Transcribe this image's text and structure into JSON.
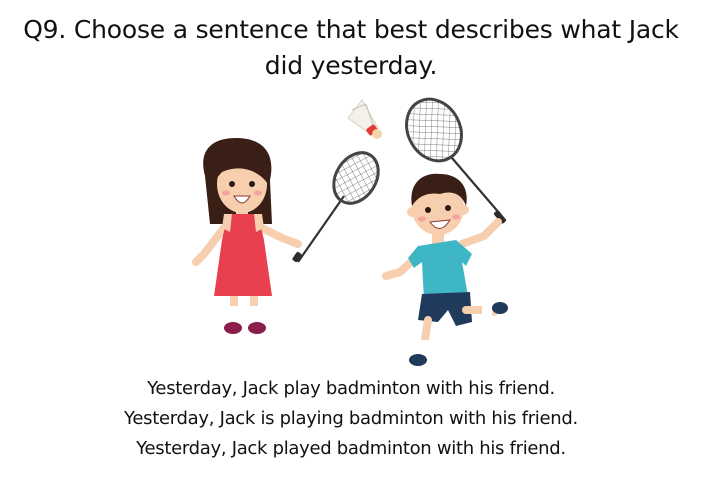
{
  "question": {
    "line1": "Q9. Choose a sentence that best describes what Jack",
    "line2": "did yesterday."
  },
  "options": [
    "Yesterday, Jack play badminton with his friend.",
    "Yesterday, Jack is playing badminton with his friend.",
    "Yesterday, Jack played badminton with his friend."
  ],
  "colors": {
    "girl_dress": "#e8404f",
    "boy_shirt": "#3eb6c6",
    "boy_shorts": "#1f3a5a",
    "hair": "#3a1f16",
    "skin": "#f7cfae"
  }
}
